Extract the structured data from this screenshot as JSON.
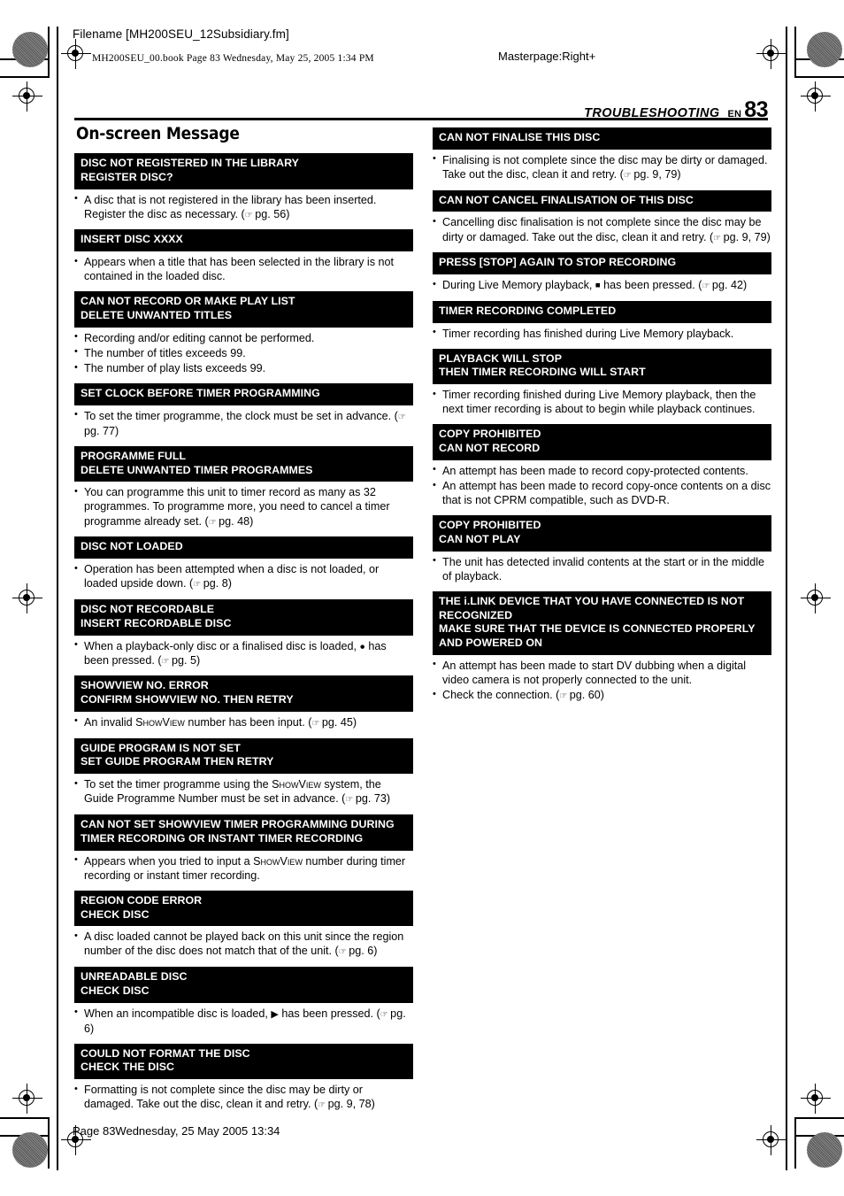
{
  "header": {
    "filename": "Filename [MH200SEU_12Subsidiary.fm]",
    "bookline": "MH200SEU_00.book  Page 83  Wednesday, May 25, 2005  1:34 PM",
    "masterpage": "Masterpage:Right+",
    "running_title": "TROUBLESHOOTING",
    "lang_code": "EN",
    "page_number": "83"
  },
  "section_title": "On-screen Message",
  "footer": "Page 83Wednesday, 25 May 2005  13:34",
  "left_column": [
    {
      "heading": [
        "DISC NOT REGISTERED IN THE LIBRARY",
        "REGISTER DISC?"
      ],
      "notes": [
        "A disc that is not registered in the library has been inserted. Register the disc as necessary. (☞ pg. 56)"
      ]
    },
    {
      "heading": [
        "INSERT DISC XXXX"
      ],
      "notes": [
        "Appears when a title that has been selected in the library is not contained in the loaded disc."
      ]
    },
    {
      "heading": [
        "CAN NOT RECORD OR MAKE PLAY LIST",
        "DELETE UNWANTED TITLES"
      ],
      "notes": [
        "Recording and/or editing cannot be performed.",
        "The number of titles exceeds 99.",
        "The number of play lists exceeds 99."
      ]
    },
    {
      "heading": [
        "SET CLOCK BEFORE TIMER PROGRAMMING"
      ],
      "notes": [
        "To set the timer programme, the clock must be set in advance. (☞ pg. 77)"
      ]
    },
    {
      "heading": [
        "PROGRAMME FULL",
        "DELETE UNWANTED TIMER PROGRAMMES"
      ],
      "notes": [
        "You can programme this unit to timer record as many as 32 programmes. To programme more, you need to cancel a timer programme already set. (☞ pg. 48)"
      ]
    },
    {
      "heading": [
        "DISC NOT LOADED"
      ],
      "notes": [
        "Operation has been attempted when a disc is not loaded, or loaded upside down. (☞ pg. 8)"
      ]
    },
    {
      "heading": [
        "DISC NOT RECORDABLE",
        "INSERT RECORDABLE DISC"
      ],
      "notes": [
        "When a playback-only disc or a finalised disc is loaded, ● has been pressed. (☞ pg. 5)"
      ]
    },
    {
      "heading": [
        "SHOWVIEW NO. ERROR",
        "CONFIRM SHOWVIEW NO. THEN RETRY"
      ],
      "notes": [
        "An invalid SHOWVIEW number has been input. (☞ pg. 45)"
      ]
    },
    {
      "heading": [
        "GUIDE PROGRAM IS NOT SET",
        "SET GUIDE PROGRAM THEN RETRY"
      ],
      "notes": [
        "To set the timer programme using the SHOWVIEW system, the Guide Programme Number must be set in advance. (☞ pg. 73)"
      ]
    },
    {
      "heading": [
        "CAN NOT SET SHOWVIEW TIMER PROGRAMMING DURING",
        "TIMER RECORDING OR INSTANT TIMER RECORDING"
      ],
      "notes": [
        "Appears when you tried to input a SHOWVIEW number during timer recording or instant timer recording."
      ]
    },
    {
      "heading": [
        "REGION CODE ERROR",
        "CHECK DISC"
      ],
      "notes": [
        "A disc loaded cannot be played back on this unit since the region number of the disc does not match that of the unit. (☞ pg. 6)"
      ]
    },
    {
      "heading": [
        "UNREADABLE DISC",
        "CHECK DISC"
      ],
      "notes": [
        "When an incompatible disc is loaded, ▶ has been pressed. (☞ pg. 6)"
      ]
    },
    {
      "heading": [
        "COULD NOT FORMAT THE DISC",
        "CHECK THE DISC"
      ],
      "notes": [
        "Formatting is not complete since the disc may be dirty or damaged. Take out the disc, clean it and retry. (☞ pg. 9, 78)"
      ]
    }
  ],
  "right_column": [
    {
      "heading": [
        "CAN NOT FINALISE THIS DISC"
      ],
      "notes": [
        "Finalising is not complete since the disc may be dirty or damaged. Take out the disc, clean it and retry. (☞ pg. 9, 79)"
      ]
    },
    {
      "heading": [
        "CAN NOT CANCEL FINALISATION OF THIS DISC"
      ],
      "notes": [
        "Cancelling disc finalisation is not complete since the disc may be dirty or damaged. Take out the disc, clean it and retry. (☞ pg. 9, 79)"
      ]
    },
    {
      "heading": [
        "PRESS [STOP] AGAIN TO STOP RECORDING"
      ],
      "notes": [
        "During Live Memory playback, ■ has been pressed. (☞ pg. 42)"
      ]
    },
    {
      "heading": [
        "TIMER RECORDING COMPLETED"
      ],
      "notes": [
        "Timer recording has finished during Live Memory playback."
      ]
    },
    {
      "heading": [
        "PLAYBACK WILL STOP",
        "THEN TIMER RECORDING WILL START"
      ],
      "notes": [
        "Timer recording finished during Live Memory playback, then the next timer recording is about to begin while playback continues."
      ]
    },
    {
      "heading": [
        "COPY PROHIBITED",
        "CAN NOT RECORD"
      ],
      "notes": [
        "An attempt has been made to record copy-protected contents.",
        "An attempt has been made to record copy-once contents on a disc that is not CPRM compatible, such as DVD-R."
      ]
    },
    {
      "heading": [
        "COPY PROHIBITED",
        "CAN NOT PLAY"
      ],
      "notes": [
        "The unit has detected invalid contents at the start or in the middle of playback."
      ]
    },
    {
      "heading": [
        "THE i.LINK DEVICE THAT YOU HAVE CONNECTED IS NOT",
        "RECOGNIZED",
        "MAKE SURE THAT THE DEVICE IS CONNECTED PROPERLY",
        "AND POWERED ON"
      ],
      "notes": [
        "An attempt has been made to start DV dubbing when a digital video camera is not properly connected to the unit.",
        "Check the connection. (☞ pg. 60)"
      ]
    }
  ]
}
